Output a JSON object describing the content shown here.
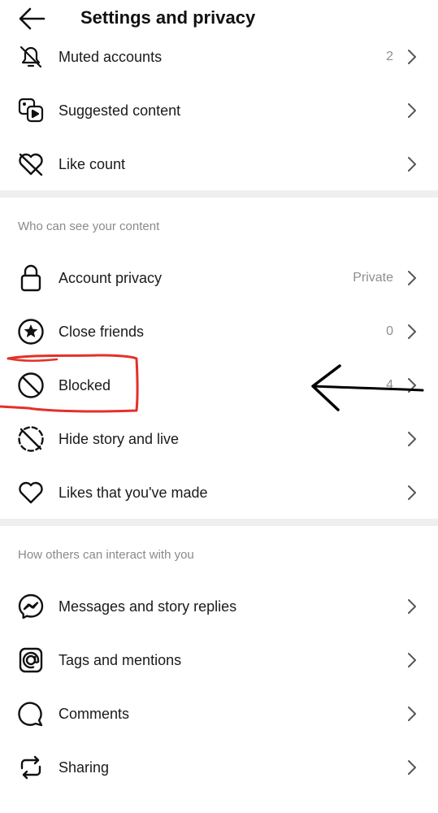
{
  "header": {
    "title": "Settings and privacy",
    "back_icon": "arrow-left-icon"
  },
  "rows_top": [
    {
      "label": "Muted accounts",
      "value": "2",
      "icon": "bell-off-icon"
    },
    {
      "label": "Suggested content",
      "value": "",
      "icon": "media-icon"
    },
    {
      "label": "Like count",
      "value": "",
      "icon": "heart-off-icon"
    }
  ],
  "section1": {
    "title": "Who can see your content",
    "items": [
      {
        "label": "Account privacy",
        "value": "Private",
        "icon": "lock-icon"
      },
      {
        "label": "Close friends",
        "value": "0",
        "icon": "star-circle-icon"
      },
      {
        "label": "Blocked",
        "value": "4",
        "icon": "block-icon"
      },
      {
        "label": "Hide story and live",
        "value": "",
        "icon": "story-off-icon"
      },
      {
        "label": "Likes that you've made",
        "value": "",
        "icon": "heart-icon"
      }
    ]
  },
  "section2": {
    "title": "How others can interact with you",
    "items": [
      {
        "label": "Messages and story replies",
        "value": "",
        "icon": "messenger-icon"
      },
      {
        "label": "Tags and mentions",
        "value": "",
        "icon": "at-icon"
      },
      {
        "label": "Comments",
        "value": "",
        "icon": "comment-icon"
      },
      {
        "label": "Sharing",
        "value": "",
        "icon": "share-icon"
      }
    ]
  },
  "colors": {
    "annotation_red": "#e53028",
    "annotation_black": "#000000",
    "divider": "#efefef"
  }
}
